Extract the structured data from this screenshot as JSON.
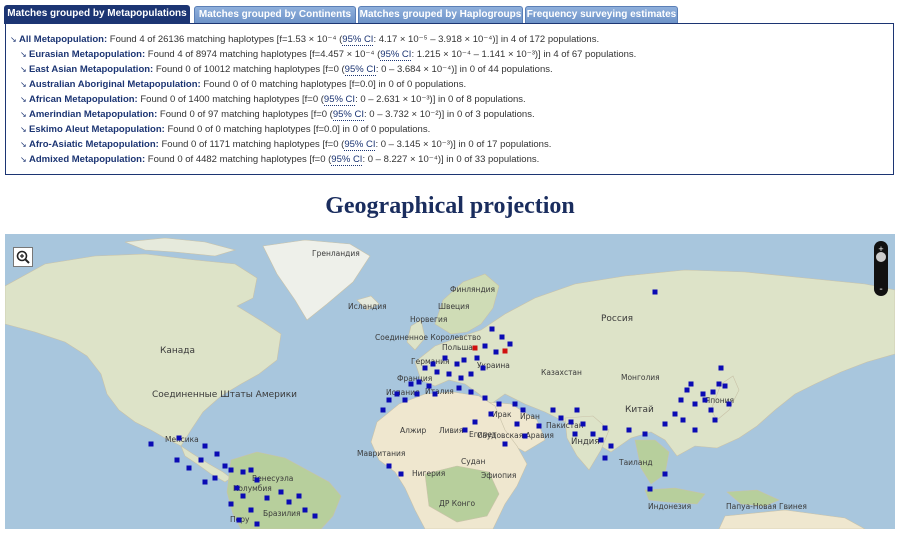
{
  "tabs": [
    {
      "label": "Matches grouped by Metapopulations",
      "active": true
    },
    {
      "label": "Matches grouped by Continents",
      "active": false
    },
    {
      "label": "Matches grouped by Haplogroups",
      "active": false
    },
    {
      "label": "Frequency surveying estimates",
      "active": false
    }
  ],
  "results": [
    {
      "name": "All Metapopulation:",
      "found": "Found 4 of 26136 matching haplotypes [f=1.53 × 10⁻⁴ (",
      "ci_label": "95% CI",
      "ci": ": 4.17 × 10⁻⁵ – 3.918 × 10⁻⁴)] in 4 of 172 populations."
    },
    {
      "name": "Eurasian Metapopulation:",
      "found": "Found 4 of 8974 matching haplotypes [f=4.457 × 10⁻⁴ (",
      "ci_label": "95% CI",
      "ci": ": 1.215 × 10⁻⁴ – 1.141 × 10⁻³)] in 4 of 67 populations."
    },
    {
      "name": "East Asian Metapopulation:",
      "found": "Found 0 of 10012 matching haplotypes [f=0 (",
      "ci_label": "95% CI",
      "ci": ": 0 – 3.684 × 10⁻⁴)] in 0 of 44 populations."
    },
    {
      "name": "Australian Aboriginal Metapopulation:",
      "found": "Found 0 of 0 matching haplotypes [f=0.0] in 0 of 0 populations.",
      "ci_label": "",
      "ci": ""
    },
    {
      "name": "African Metapopulation:",
      "found": "Found 0 of 1400 matching haplotypes [f=0 (",
      "ci_label": "95% CI",
      "ci": ": 0 – 2.631 × 10⁻³)] in 0 of 8 populations."
    },
    {
      "name": "Amerindian Metapopulation:",
      "found": "Found 0 of 97 matching haplotypes [f=0 (",
      "ci_label": "95% CI",
      "ci": ": 0 – 3.732 × 10⁻²)] in 0 of 3 populations."
    },
    {
      "name": "Eskimo Aleut Metapopulation:",
      "found": "Found 0 of 0 matching haplotypes [f=0.0] in 0 of 0 populations.",
      "ci_label": "",
      "ci": ""
    },
    {
      "name": "Afro-Asiatic Metapopulation:",
      "found": "Found 0 of 1171 matching haplotypes [f=0 (",
      "ci_label": "95% CI",
      "ci": ": 0 – 3.145 × 10⁻³)] in 0 of 17 populations."
    },
    {
      "name": "Admixed Metapopulation:",
      "found": "Found 0 of 4482 matching haplotypes [f=0 (",
      "ci_label": "95% CI",
      "ci": ": 0 – 8.227 × 10⁻⁴)] in 0 of 33 populations."
    }
  ],
  "section_title": "Geographical projection",
  "map": {
    "labels": [
      "Гренландия",
      "Финляндия",
      "Исландия",
      "Норвегия",
      "Швеция",
      "Соединенное Королевство",
      "Польша",
      "Германия",
      "Франция",
      "Украина",
      "Испания",
      "Италия",
      "Казахстан",
      "Монголия",
      "Россия",
      "Китай",
      "Япония",
      "Канада",
      "Соединенные Штаты Америки",
      "Мексика",
      "Венесуэла",
      "Колумбия",
      "Перу",
      "Бразилия",
      "Алжир",
      "Ливия",
      "Египет",
      "Ирак",
      "Иран",
      "Пакистан",
      "Индия",
      "Саудовская Аравия",
      "Судан",
      "Мавритания",
      "Нигерия",
      "Эфиопия",
      "ДР Конго",
      "Таиланд",
      "Индонезия",
      "Папуа-Новая Гвинея"
    ],
    "marker_color": "#0a0ab4",
    "highlight_color": "#d01010",
    "colors": {
      "ocean": "#a8c6dd",
      "land": "#dde3c8",
      "desert": "#efe7cf",
      "forest": "#b7cf9c"
    }
  }
}
